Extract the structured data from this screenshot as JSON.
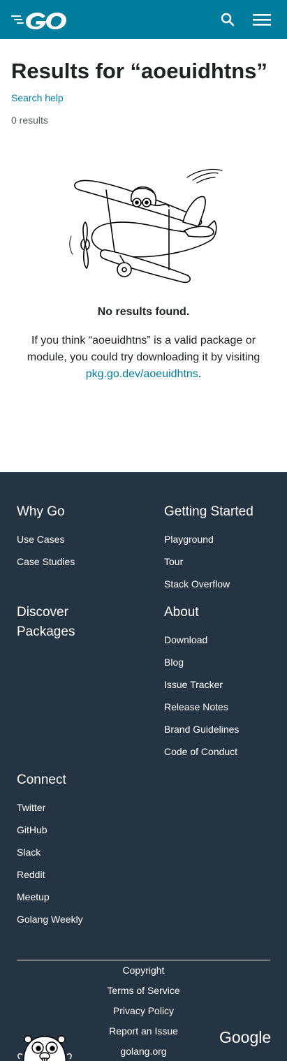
{
  "header": {
    "logo_alt": "Go",
    "search_icon": "search-icon",
    "menu_icon": "hamburger-menu-icon",
    "bg_color": "#007d9c"
  },
  "results": {
    "title": "Results for “aoeuidhtns”",
    "search_help": "Search help",
    "count": "0 results",
    "illustration": "gopher-biplane-icon",
    "no_results_heading": "No results found.",
    "message_prefix": "If you think “aoeuidhtns” is a valid package or module, you could try downloading it by visiting",
    "message_link": "pkg.go.dev/aoeuidhtns",
    "message_suffix": "."
  },
  "footer": {
    "bg_color": "#253443",
    "columns": [
      {
        "heading": "Why Go",
        "links": [
          "Use Cases",
          "Case Studies"
        ]
      },
      {
        "heading": "Getting Started",
        "links": [
          "Playground",
          "Tour",
          "Stack Overflow"
        ]
      },
      {
        "heading": "Discover Packages",
        "links": []
      },
      {
        "heading": "About",
        "links": [
          "Download",
          "Blog",
          "Issue Tracker",
          "Release Notes",
          "Brand Guidelines",
          "Code of Conduct"
        ]
      },
      {
        "heading": "Connect",
        "links": [
          "Twitter",
          "GitHub",
          "Slack",
          "Reddit",
          "Meetup",
          "Golang Weekly"
        ]
      }
    ],
    "bottom_links": [
      "Copyright",
      "Terms of Service",
      "Privacy Policy",
      "Report an Issue",
      "golang.org"
    ],
    "gopher_icon": "gopher-mascot-icon",
    "google_logo": "Google"
  }
}
